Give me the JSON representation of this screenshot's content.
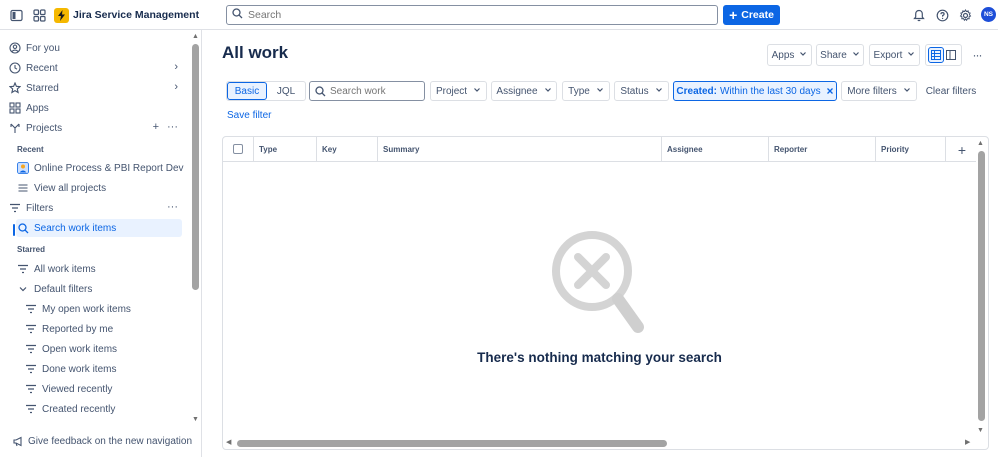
{
  "topbar": {
    "app_name": "Jira Service Management",
    "search_placeholder": "Search",
    "create_label": "Create",
    "avatar_initials": "NS"
  },
  "sidebar": {
    "top_items": [
      {
        "label": "For you",
        "icon": "user-circle-icon"
      },
      {
        "label": "Recent",
        "icon": "clock-icon"
      },
      {
        "label": "Starred",
        "icon": "star-icon"
      },
      {
        "label": "Apps",
        "icon": "apps-grid-icon"
      },
      {
        "label": "Projects",
        "icon": "projects-icon"
      }
    ],
    "recent_heading": "Recent",
    "recent_project": "Online Process & PBI Report Dev",
    "view_all_projects": "View all projects",
    "filters_label": "Filters",
    "search_work_items": "Search work items",
    "starred_heading": "Starred",
    "all_work_items": "All work items",
    "default_filters": "Default filters",
    "default_filter_items": [
      "My open work items",
      "Reported by me",
      "Open work items",
      "Done work items",
      "Viewed recently",
      "Created recently"
    ],
    "feedback": "Give feedback on the new navigation"
  },
  "main": {
    "title": "All work",
    "header_buttons": {
      "apps": "Apps",
      "share": "Share",
      "export": "Export"
    },
    "mode_tabs": [
      "Basic",
      "JQL"
    ],
    "search_placeholder": "Search work",
    "filters": {
      "project": "Project",
      "assignee": "Assignee",
      "type": "Type",
      "status": "Status",
      "created_key": "Created:",
      "created_value": "Within the last 30 days",
      "more_filters": "More filters",
      "clear_filters": "Clear filters"
    },
    "save_filter": "Save filter",
    "columns": [
      "Type",
      "Key",
      "Summary",
      "Assignee",
      "Reporter",
      "Priority"
    ],
    "empty_message": "There's nothing matching your search"
  },
  "colors": {
    "accent": "#0c66e4",
    "brand_logo": "#f5b800",
    "avatar": "#1d4ed8"
  }
}
